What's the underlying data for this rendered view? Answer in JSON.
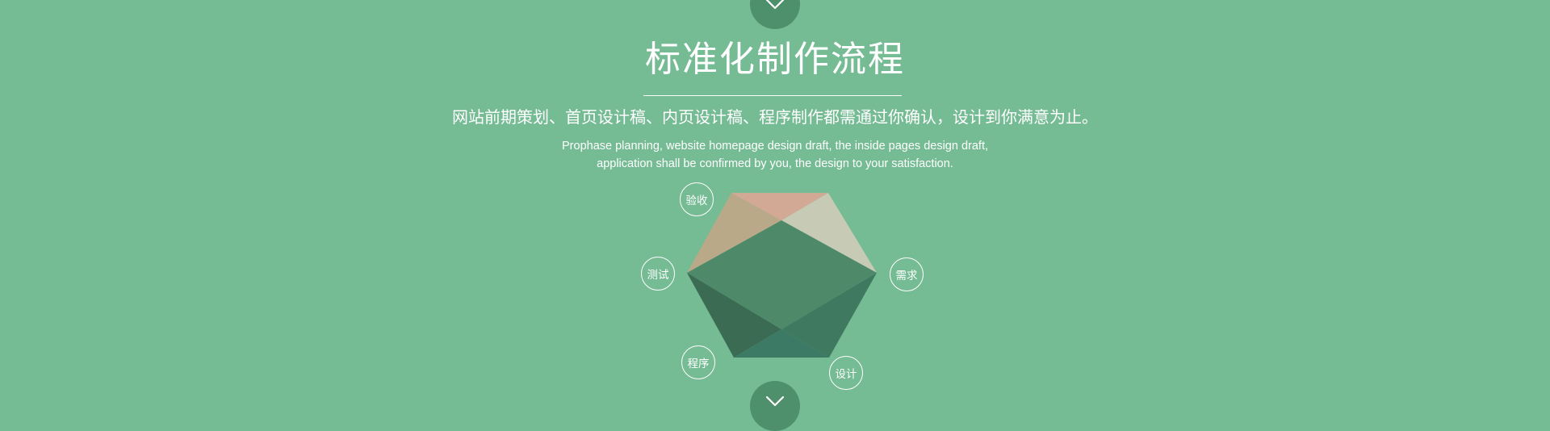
{
  "colors": {
    "background": "#75bb94",
    "nav_circle": "#4e8f6c",
    "divider": "#ffffff",
    "hex_top": "#b9a989",
    "hex_top_pink": "#d1a995",
    "hex_top_right": "#c7cab4",
    "hex_center": "#4e8a6a",
    "hex_left_lower": "#3b6b53",
    "hex_right_lower": "#3f7a60",
    "hex_bottom": "#3d7a66"
  },
  "nav": {
    "top_icon": "chevron-down-icon",
    "bottom_icon": "chevron-down-icon"
  },
  "title": "标准化制作流程",
  "subtitle_cn": "网站前期策划、首页设计稿、内页设计稿、程序制作都需通过你确认，设计到你满意为止。",
  "subtitle_en": {
    "line1": "Prophase planning, website homepage design draft, the inside pages design draft,",
    "line2": "application shall be confirmed by you, the design to your satisfaction."
  },
  "steps": [
    {
      "label": "需求"
    },
    {
      "label": "设计"
    },
    {
      "label": "程序"
    },
    {
      "label": "测试"
    },
    {
      "label": "验收"
    }
  ]
}
